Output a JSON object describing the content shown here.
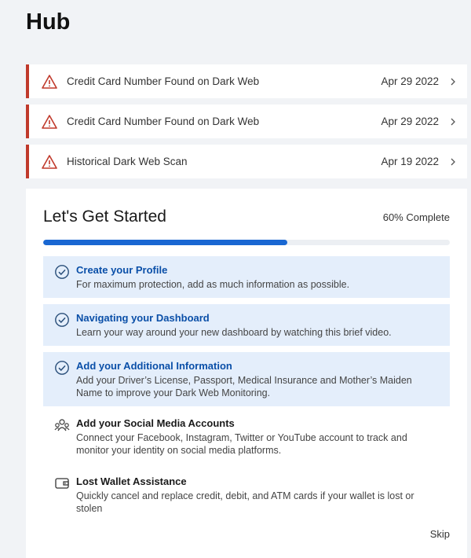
{
  "page": {
    "title": "Hub"
  },
  "alerts": [
    {
      "title": "Credit Card Number Found on Dark Web",
      "date": "Apr 29 2022"
    },
    {
      "title": "Credit Card Number Found on Dark Web",
      "date": "Apr 29 2022"
    },
    {
      "title": "Historical Dark Web Scan",
      "date": "Apr 19 2022"
    }
  ],
  "onboarding": {
    "title": "Let's Get Started",
    "progress_label": "60% Complete",
    "progress_fraction": 0.6,
    "skip_label": "Skip",
    "steps": [
      {
        "icon": "check-circle-icon",
        "done": true,
        "title": "Create your Profile",
        "desc": "For maximum protection, add as much information as possible."
      },
      {
        "icon": "check-circle-icon",
        "done": true,
        "title": "Navigating your Dashboard",
        "desc": "Learn your way around your new dashboard by watching this brief video."
      },
      {
        "icon": "check-circle-icon",
        "done": true,
        "title": "Add your Additional Information",
        "desc": "Add your Driver’s License, Passport, Medical Insurance and Mother’s Maiden Name to improve your Dark Web Monitoring."
      },
      {
        "icon": "social-accounts-icon",
        "done": false,
        "title": "Add your Social Media Accounts",
        "desc": "Connect your Facebook, Instagram, Twitter or YouTube account to track and monitor your identity on social media platforms."
      },
      {
        "icon": "wallet-icon",
        "done": false,
        "title": "Lost Wallet Assistance",
        "desc": "Quickly cancel and replace credit, debit, and ATM cards if your wallet is lost or stolen"
      }
    ]
  },
  "colors": {
    "alert_accent": "#c0392b",
    "progress": "#1967d2",
    "done_bg": "#e4eefb",
    "done_title": "#0a4fa8"
  }
}
